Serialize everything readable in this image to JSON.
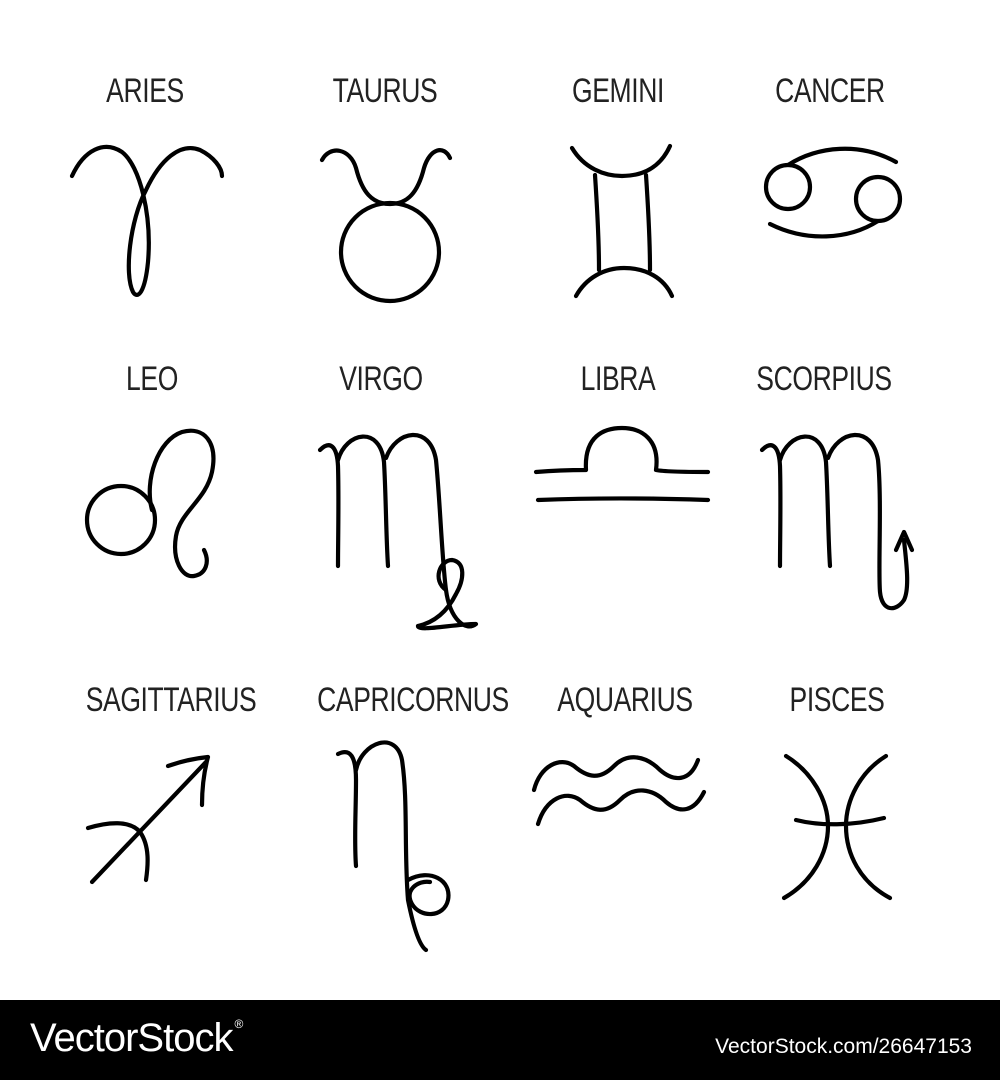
{
  "signs": [
    {
      "label": "ARIES",
      "icon": "aries-icon"
    },
    {
      "label": "TAURUS",
      "icon": "taurus-icon"
    },
    {
      "label": "GEMINI",
      "icon": "gemini-icon"
    },
    {
      "label": "CANCER",
      "icon": "cancer-icon"
    },
    {
      "label": "LEO",
      "icon": "leo-icon"
    },
    {
      "label": "VIRGO",
      "icon": "virgo-icon"
    },
    {
      "label": "LIBRA",
      "icon": "libra-icon"
    },
    {
      "label": "SCORPIUS",
      "icon": "scorpius-icon"
    },
    {
      "label": "SAGITTARIUS",
      "icon": "sagittarius-icon"
    },
    {
      "label": "CAPRICORNUS",
      "icon": "capricornus-icon"
    },
    {
      "label": "AQUARIUS",
      "icon": "aquarius-icon"
    },
    {
      "label": "PISCES",
      "icon": "pisces-icon"
    }
  ],
  "footer": {
    "brand": "VectorStock",
    "registered": "®",
    "stock_id": "VectorStock.com/26647153"
  },
  "colors": {
    "background": "#ffffff",
    "ink": "#000000",
    "label": "#222222",
    "footer_bg": "#000000",
    "footer_text": "#ffffff"
  }
}
